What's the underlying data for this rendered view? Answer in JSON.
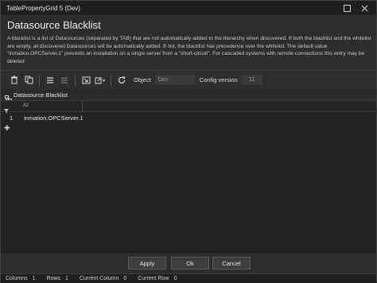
{
  "window": {
    "title": "TablePropertyGrid 5 (Dev)"
  },
  "page": {
    "heading": "Datasource Blacklist",
    "description": "A blacklist is a list of Datasources (separated by TAB) that are not automatically added to the hierarchy when discovered. If both the blacklist and the whitelist are empty, all discovered Datasources will be automatically added. If not, the blacklist has precedence over the whitelist. The default value \"inmation.OPCServer.1\" prevents an installation on a single server from a \"short-circuit\". For cascaded systems with remote connections this entry may be deleted"
  },
  "toolbar": {
    "object_label": "Object",
    "object_value": "Dev",
    "config_label": "Config version",
    "config_value": "11"
  },
  "sheet": {
    "tab_label": "Datasource Blacklist",
    "sort_label": "Az"
  },
  "rows": [
    {
      "num": "1",
      "value": "inmation.OPCServer.1"
    }
  ],
  "buttons": {
    "apply": "Apply",
    "ok": "Ok",
    "cancel": "Cancel"
  },
  "status": {
    "columns_label": "Columns",
    "columns_value": "1",
    "rows_label": "Rows",
    "rows_value": "1",
    "current_column_label": "Current Column",
    "current_column_value": "0",
    "current_row_label": "Current Row",
    "current_row_value": "0"
  }
}
